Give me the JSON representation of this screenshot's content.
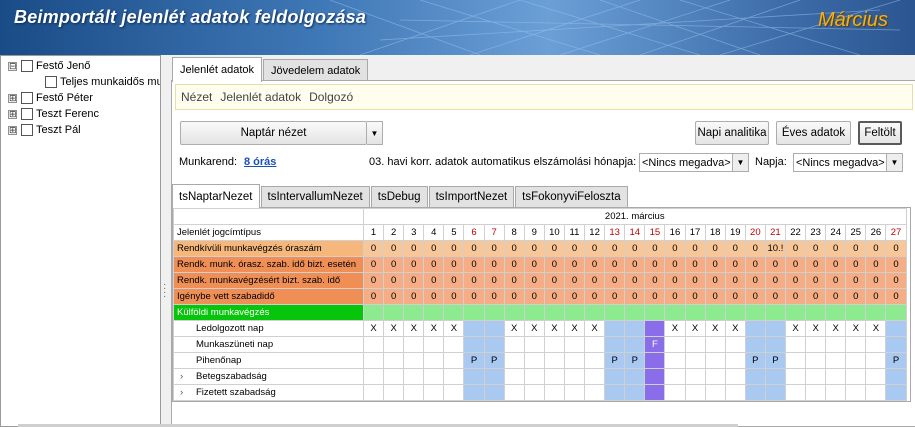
{
  "header": {
    "title": "Beimportált jelenlét adatok feldolgozása",
    "month": "Március"
  },
  "tree": [
    {
      "label": "Festő Jenő",
      "expander": "⊟",
      "level": 0
    },
    {
      "label": "Teljes munkaidős mu",
      "expander": "",
      "level": 1
    },
    {
      "label": "Festő Péter",
      "expander": "⊞",
      "level": 0
    },
    {
      "label": "Teszt Ferenc",
      "expander": "⊞",
      "level": 0
    },
    {
      "label": "Teszt Pál",
      "expander": "⊞",
      "level": 0
    }
  ],
  "tabs": [
    "Jelenlét adatok",
    "Jövedelem adatok"
  ],
  "menu": [
    "Nézet",
    "Jelenlét adatok",
    "Dolgozó"
  ],
  "toolbar": {
    "view_combo": "Naptár nézet",
    "napi_analitika": "Napi analitika",
    "eves_adatok": "Éves adatok",
    "feltolt": "Feltölt"
  },
  "info": {
    "munkarend_label": "Munkarend:",
    "munkarend_value": "8 órás",
    "korr_label": "03. havi korr. adatok automatikus elszámolási hónapja:",
    "korr_value": "<Nincs megadva>",
    "napja_label": "Napja:",
    "napja_value": "<Nincs megadva>"
  },
  "inner_tabs": [
    "tsNaptarNezet",
    "tsIntervallumNezet",
    "tsDebug",
    "tsImportNezet",
    "tsFokonyviFeloszta"
  ],
  "grid": {
    "month_header": "2021. március",
    "corner_label": "Jelenlét jogcímtípus",
    "days": [
      1,
      2,
      3,
      4,
      5,
      6,
      7,
      8,
      9,
      10,
      11,
      12,
      13,
      14,
      15,
      16,
      17,
      18,
      19,
      20,
      21,
      22,
      23,
      24,
      25,
      26,
      27
    ],
    "weekend_days": [
      6,
      7,
      13,
      14,
      15,
      20,
      21,
      27
    ],
    "orange_rows": [
      {
        "label": "Rendkívüli munkavégzés óraszám",
        "style": "light",
        "values": [
          "0",
          "0",
          "0",
          "0",
          "0",
          "0",
          "0",
          "0",
          "0",
          "0",
          "0",
          "0",
          "0",
          "0",
          "0",
          "0",
          "0",
          "0",
          "0",
          "0",
          "10.!",
          "0",
          "0",
          "0",
          "0",
          "0",
          "0"
        ]
      },
      {
        "label": "Rendk. munk. órasz. szab. idő bizt. esetén",
        "style": "dark",
        "values": [
          "0",
          "0",
          "0",
          "0",
          "0",
          "0",
          "0",
          "0",
          "0",
          "0",
          "0",
          "0",
          "0",
          "0",
          "0",
          "0",
          "0",
          "0",
          "0",
          "0",
          "0",
          "0",
          "0",
          "0",
          "0",
          "0",
          "0"
        ]
      },
      {
        "label": "Rendk. munkavégzésért bizt. szab. idő",
        "style": "dark",
        "values": [
          "0",
          "0",
          "0",
          "0",
          "0",
          "0",
          "0",
          "0",
          "0",
          "0",
          "0",
          "0",
          "0",
          "0",
          "0",
          "0",
          "0",
          "0",
          "0",
          "0",
          "0",
          "0",
          "0",
          "0",
          "0",
          "0",
          "0"
        ]
      },
      {
        "label": "Igénybe vett szabadidő",
        "style": "dark",
        "values": [
          "0",
          "0",
          "0",
          "0",
          "0",
          "0",
          "0",
          "0",
          "0",
          "0",
          "0",
          "0",
          "0",
          "0",
          "0",
          "0",
          "0",
          "0",
          "0",
          "0",
          "0",
          "0",
          "0",
          "0",
          "0",
          "0",
          "0"
        ]
      }
    ],
    "green_row": {
      "label": "Külföldi munkavégzés"
    },
    "day_rows": [
      {
        "label": "Ledolgozott nap",
        "expander": "",
        "values": [
          "X",
          "X",
          "X",
          "X",
          "X",
          "",
          "",
          "X",
          "X",
          "X",
          "X",
          "X",
          "",
          "",
          "",
          "X",
          "X",
          "X",
          "X",
          "",
          "",
          "X",
          "X",
          "X",
          "X",
          "X",
          ""
        ]
      },
      {
        "label": "Munkaszüneti nap",
        "expander": "",
        "values": [
          "",
          "",
          "",
          "",
          "",
          "",
          "",
          "",
          "",
          "",
          "",
          "",
          "",
          "",
          "F",
          "",
          "",
          "",
          "",
          "",
          "",
          "",
          "",
          "",
          "",
          "",
          ""
        ]
      },
      {
        "label": "Pihenőnap",
        "expander": "",
        "values": [
          "",
          "",
          "",
          "",
          "",
          "P",
          "P",
          "",
          "",
          "",
          "",
          "",
          "P",
          "P",
          "",
          "",
          "",
          "",
          "",
          "P",
          "P",
          "",
          "",
          "",
          "",
          "",
          "P"
        ]
      },
      {
        "label": "Betegszabadság",
        "expander": "›",
        "values": [
          "",
          "",
          "",
          "",
          "",
          "",
          "",
          "",
          "",
          "",
          "",
          "",
          "",
          "",
          "",
          "",
          "",
          "",
          "",
          "",
          "",
          "",
          "",
          "",
          "",
          "",
          ""
        ]
      },
      {
        "label": "Fizetett szabadság",
        "expander": "›",
        "values": [
          "",
          "",
          "",
          "",
          "",
          "",
          "",
          "",
          "",
          "",
          "",
          "",
          "",
          "",
          "",
          "",
          "",
          "",
          "",
          "",
          "",
          "",
          "",
          "",
          "",
          "",
          ""
        ]
      }
    ]
  }
}
